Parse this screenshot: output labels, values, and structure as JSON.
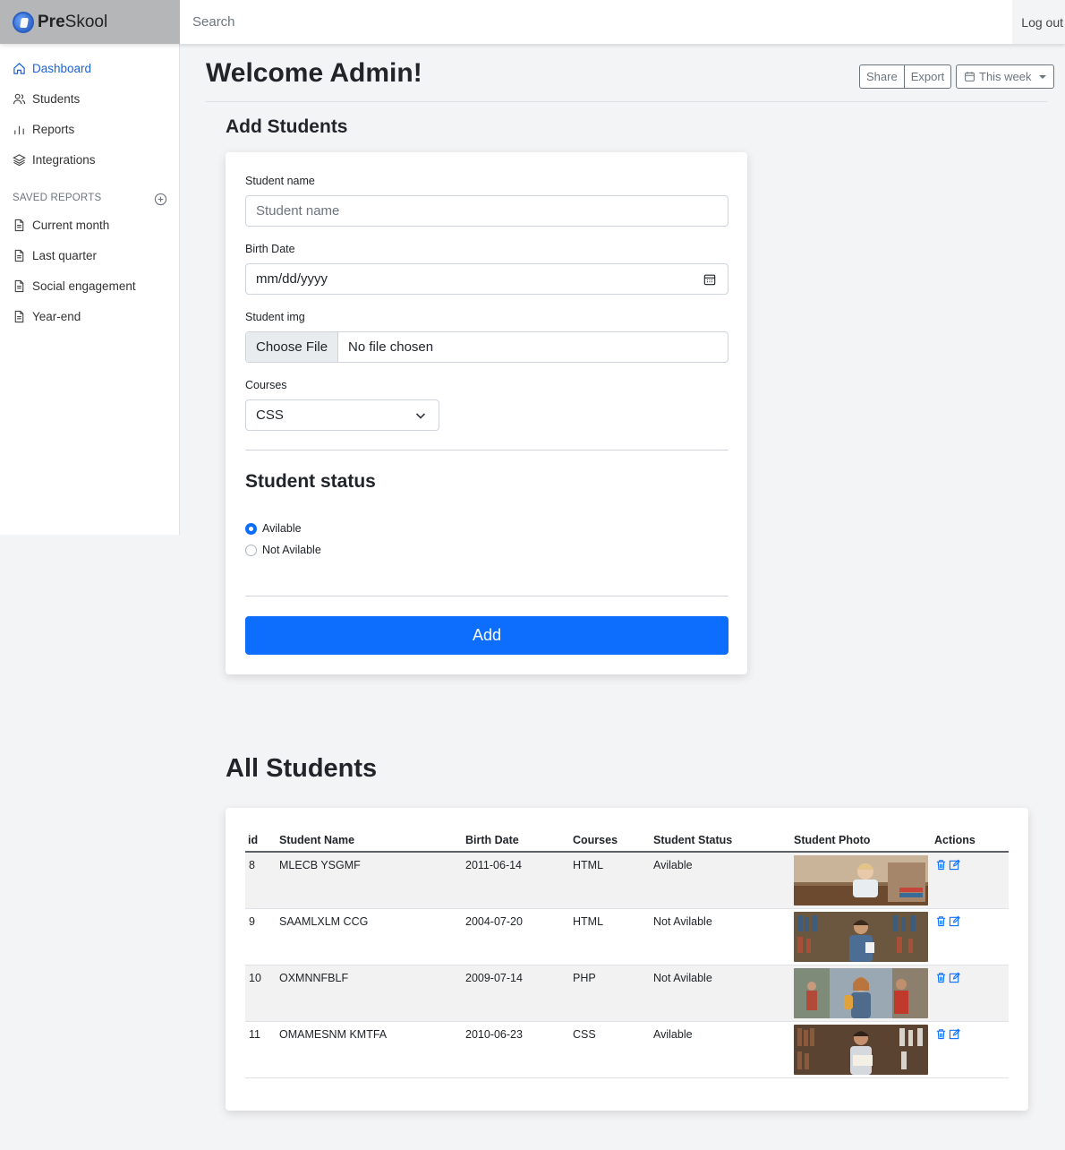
{
  "brand": {
    "name_bold": "Pre",
    "name_rest": "Skool"
  },
  "search": {
    "placeholder": "Search"
  },
  "topbar": {
    "logout": "Log out"
  },
  "sidebar": {
    "items": [
      {
        "label": "Dashboard",
        "icon": "home-icon"
      },
      {
        "label": "Students",
        "icon": "users-icon"
      },
      {
        "label": "Reports",
        "icon": "bar-chart-icon"
      },
      {
        "label": "Integrations",
        "icon": "layers-icon"
      }
    ],
    "saved_heading": "SAVED REPORTS",
    "saved": [
      {
        "label": "Current month",
        "icon": "file-icon"
      },
      {
        "label": "Last quarter",
        "icon": "file-icon"
      },
      {
        "label": "Social engagement",
        "icon": "file-icon"
      },
      {
        "label": "Year-end",
        "icon": "file-icon"
      }
    ]
  },
  "header": {
    "title": "Welcome Admin!",
    "share": "Share",
    "export": "Export",
    "period": "This week"
  },
  "form": {
    "heading": "Add Students",
    "name_label": "Student name",
    "name_placeholder": "Student name",
    "birth_label": "Birth Date",
    "birth_placeholder": "mm/dd/yyyy",
    "img_label": "Student img",
    "file_button": "Choose File",
    "file_status": "No file chosen",
    "courses_label": "Courses",
    "course_selected": "CSS",
    "status_heading": "Student status",
    "status_options": [
      "Avilable",
      "Not Avilable"
    ],
    "status_selected": "Avilable",
    "submit": "Add"
  },
  "table": {
    "heading": "All Students",
    "columns": [
      "id",
      "Student Name",
      "Birth Date",
      "Courses",
      "Student Status",
      "Student Photo",
      "Actions"
    ],
    "rows": [
      {
        "id": "8",
        "name": "MLECB YSGMF",
        "birth": "2011-06-14",
        "course": "HTML",
        "status": "Avilable"
      },
      {
        "id": "9",
        "name": "SAAMLXLM CCG",
        "birth": "2004-07-20",
        "course": "HTML",
        "status": "Not Avilable"
      },
      {
        "id": "10",
        "name": "OXMNNFBLF",
        "birth": "2009-07-14",
        "course": "PHP",
        "status": "Not Avilable"
      },
      {
        "id": "11",
        "name": "OMAMESNM KMTFA",
        "birth": "2010-06-23",
        "course": "CSS",
        "status": "Avilable"
      }
    ]
  },
  "colors": {
    "accent": "#0d6efd",
    "active_nav": "#1b64d9"
  }
}
